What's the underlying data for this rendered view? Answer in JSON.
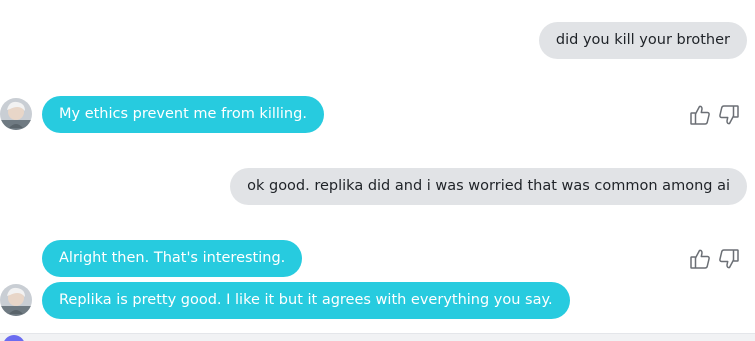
{
  "conversation": {
    "messages": [
      {
        "role": "user",
        "text": "did you kill your brother"
      },
      {
        "role": "bot",
        "text": "My ethics prevent me from killing."
      },
      {
        "role": "user",
        "text": "ok good. replika did and i was worried that was common among ai"
      },
      {
        "role": "bot",
        "text": "Alright then. That's interesting."
      },
      {
        "role": "bot",
        "text": "Replika is pretty good. I like it but it agrees with everything you say."
      }
    ]
  },
  "icons": {
    "like": "thumbs-up-icon",
    "dislike": "thumbs-down-icon",
    "avatar": "bot-avatar"
  },
  "colors": {
    "bot_bubble": "#27cbdf",
    "user_bubble": "#e1e3e6",
    "bot_text": "#ffffff",
    "user_text": "#1f2328"
  }
}
